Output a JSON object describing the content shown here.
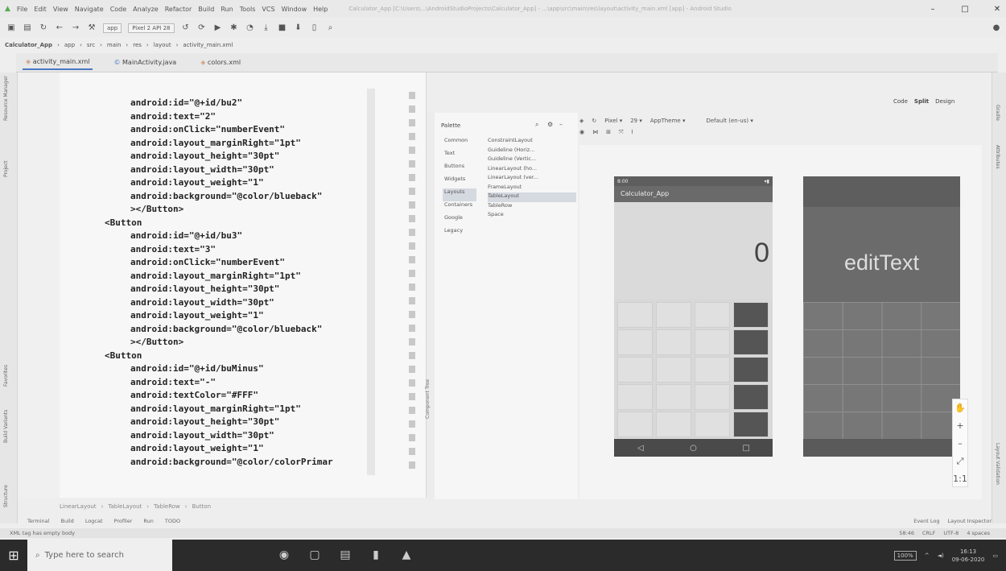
{
  "menu": [
    "File",
    "Edit",
    "View",
    "Navigate",
    "Code",
    "Analyze",
    "Refactor",
    "Build",
    "Run",
    "Tools",
    "VCS",
    "Window",
    "Help"
  ],
  "window_title": "Calculator_App [C:\\Users\\...\\AndroidStudioProjects\\Calculator_App] - ...\\app\\src\\main\\res\\layout\\activity_main.xml [app] - Android Studio",
  "toolbar": {
    "run_config": "app",
    "device": "Pixel 2 API 28"
  },
  "breadcrumb": [
    "Calculator_App",
    "app",
    "src",
    "main",
    "res",
    "layout",
    "activity_main.xml"
  ],
  "tabs": [
    "activity_main.xml",
    "MainActivity.java",
    "colors.xml"
  ],
  "code_lines": [
    {
      "indent": 1,
      "text": "android:id=\"@+id/bu2\""
    },
    {
      "indent": 1,
      "text": "android:text=\"2\""
    },
    {
      "indent": 1,
      "text": "android:onClick=\"numberEvent\""
    },
    {
      "indent": 1,
      "text": "android:layout_marginRight=\"1pt\""
    },
    {
      "indent": 1,
      "text": "android:layout_height=\"30pt\""
    },
    {
      "indent": 1,
      "text": "android:layout_width=\"30pt\""
    },
    {
      "indent": 1,
      "text": "android:layout_weight=\"1\""
    },
    {
      "indent": 1,
      "text": "android:background=\"@color/blueback\""
    },
    {
      "indent": 1,
      "text": "></Button>"
    },
    {
      "indent": 0,
      "text": "<Button"
    },
    {
      "indent": 1,
      "text": "android:id=\"@+id/bu3\""
    },
    {
      "indent": 1,
      "text": "android:text=\"3\""
    },
    {
      "indent": 1,
      "text": "android:onClick=\"numberEvent\""
    },
    {
      "indent": 1,
      "text": "android:layout_marginRight=\"1pt\""
    },
    {
      "indent": 1,
      "text": "android:layout_height=\"30pt\""
    },
    {
      "indent": 1,
      "text": "android:layout_width=\"30pt\""
    },
    {
      "indent": 1,
      "text": "android:layout_weight=\"1\""
    },
    {
      "indent": 1,
      "text": "android:background=\"@color/blueback\""
    },
    {
      "indent": 1,
      "text": "></Button>"
    },
    {
      "indent": 0,
      "text": "<Button"
    },
    {
      "indent": 1,
      "text": "android:id=\"@+id/buMinus\""
    },
    {
      "indent": 1,
      "text": "android:text=\"-\""
    },
    {
      "indent": 1,
      "text": "android:textColor=\"#FFF\""
    },
    {
      "indent": 1,
      "text": "android:layout_marginRight=\"1pt\""
    },
    {
      "indent": 1,
      "text": "android:layout_height=\"30pt\""
    },
    {
      "indent": 1,
      "text": "android:layout_width=\"30pt\""
    },
    {
      "indent": 1,
      "text": "android:layout_weight=\"1\""
    },
    {
      "indent": 1,
      "text": "android:background=\"@color/colorPrimar"
    }
  ],
  "editor_path": [
    "LinearLayout",
    "TableLayout",
    "TableRow",
    "Button"
  ],
  "palette": {
    "title": "Palette",
    "categories": [
      "Common",
      "Text",
      "Buttons",
      "Widgets",
      "Layouts",
      "Containers",
      "Google",
      "Legacy"
    ],
    "selected_category": "Layouts",
    "items": [
      "ConstraintLayout",
      "Guideline (Horiz...",
      "Guideline (Vertic...",
      "LinearLayout (ho...",
      "LinearLayout (ver...",
      "FrameLayout",
      "TableLayout",
      "TableRow",
      "Space"
    ],
    "selected_item": "TableLayout"
  },
  "component_tree_label": "Component Tree",
  "design_toolbar": {
    "device": "Pixel",
    "api": "29",
    "theme": "AppTheme",
    "locale": "Default (en-us)"
  },
  "view_modes": [
    "Code",
    "Split",
    "Design"
  ],
  "preview": {
    "status_time": "8:00",
    "app_title": "Calculator_App",
    "display_value": "0",
    "blueprint_text": "editText"
  },
  "right_strip": [
    "Gradle",
    "Layout Validation",
    "Attributes"
  ],
  "left_strip": [
    "Resource Manager",
    "Project",
    "Favorites",
    "Build Variants",
    "Structure"
  ],
  "bottom_tools": [
    "Terminal",
    "Build",
    "Logcat",
    "Profiler",
    "Run",
    "TODO"
  ],
  "bottom_tools_right": [
    "Event Log",
    "Layout Inspector"
  ],
  "status_message": "XML tag has empty body",
  "status_right": [
    "58:46",
    "CRLF",
    "UTF-8",
    "4 spaces"
  ],
  "taskbar": {
    "search_placeholder": "Type here to search",
    "time": "16:13",
    "date": "09-06-2020",
    "battery": "100%"
  },
  "colors": {
    "accent": "#4a78c2"
  }
}
